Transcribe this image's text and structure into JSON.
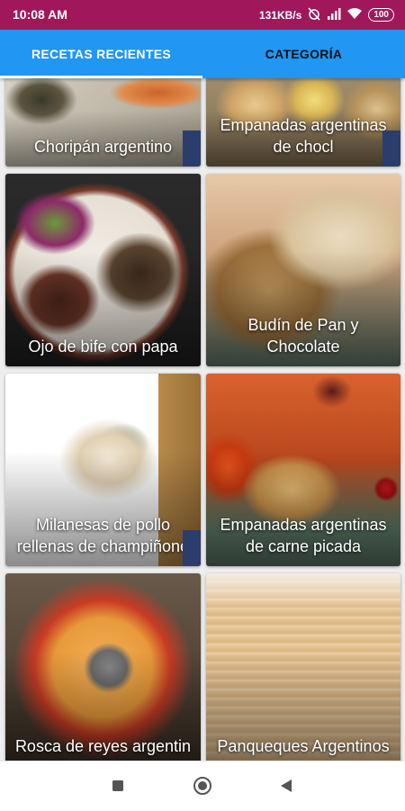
{
  "status_bar": {
    "time": "10:08 AM",
    "network_speed": "131KB/s",
    "battery": "100",
    "icons": [
      "alarm-off-icon",
      "signal-icon",
      "wifi-icon",
      "battery-icon"
    ]
  },
  "tabs": [
    {
      "label": "RECETAS RECIENTES",
      "selected": true
    },
    {
      "label": "CATEGORÍA",
      "selected": false
    }
  ],
  "recipes": [
    {
      "title": "Choripán argentino"
    },
    {
      "title": "Empanadas argentinas de chocl"
    },
    {
      "title": "Ojo de bife con papa"
    },
    {
      "title": "Budín de Pan y Chocolate"
    },
    {
      "title": "Milanesas de pollo rellenas de champiñone"
    },
    {
      "title": "Empanadas argentinas de carne picada"
    },
    {
      "title": "Rosca de reyes argentin"
    },
    {
      "title": "Panqueques Argentinos"
    }
  ],
  "nav_bar": {
    "icons": [
      "recents-square-icon",
      "home-circle-icon",
      "back-triangle-icon"
    ]
  },
  "colors": {
    "status_bar": "#a0185b",
    "tab_bar": "#2196f3",
    "tab_indicator": "#ffffff"
  }
}
